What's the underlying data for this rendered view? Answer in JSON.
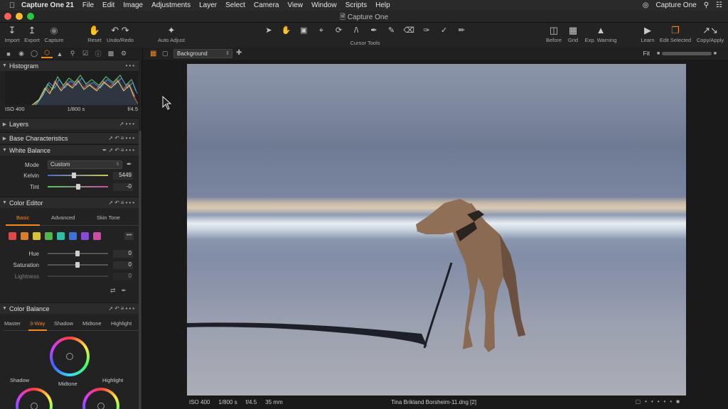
{
  "menubar": {
    "app": "Capture One 21",
    "items": [
      "File",
      "Edit",
      "Image",
      "Adjustments",
      "Layer",
      "Select",
      "Camera",
      "View",
      "Window",
      "Scripts",
      "Help"
    ],
    "right_app": "Capture One"
  },
  "window_title": "Capture One",
  "toolbar": {
    "import": "Import",
    "export": "Export",
    "capture": "Capture",
    "reset": "Reset",
    "undo_redo": "Undo/Redo",
    "auto_adjust": "Auto Adjust",
    "cursor_tools": "Cursor Tools",
    "before": "Before",
    "grid": "Grid",
    "exp_warning": "Exp. Warning",
    "learn": "Learn",
    "edit_selected": "Edit Selected",
    "copy_apply": "Copy/Apply"
  },
  "viewer_header": {
    "layer_select": "Background",
    "zoom_label": "Fit"
  },
  "histogram": {
    "title": "Histogram",
    "iso": "ISO 400",
    "shutter": "1/800 s",
    "aperture": "f/4.5"
  },
  "sections": {
    "layers": "Layers",
    "base_characteristics": "Base Characteristics",
    "white_balance": "White Balance",
    "color_editor": "Color Editor",
    "color_balance": "Color Balance"
  },
  "white_balance": {
    "mode_label": "Mode",
    "mode_value": "Custom",
    "kelvin_label": "Kelvin",
    "kelvin_value": "5449",
    "kelvin_level": 0.43,
    "tint_label": "Tint",
    "tint_value": "-0",
    "tint_level": 0.5
  },
  "color_editor": {
    "tabs": [
      "Basic",
      "Advanced",
      "Skin Tone"
    ],
    "swatches": [
      "#d94a4a",
      "#e07b2a",
      "#d9c23a",
      "#4fb84a",
      "#2fbfa8",
      "#3a73d9",
      "#8a4ad9",
      "#d24aa8"
    ],
    "hue_label": "Hue",
    "hue_value": "0",
    "saturation_label": "Saturation",
    "saturation_value": "0",
    "lightness_label": "Lightness",
    "lightness_value": "0"
  },
  "color_balance": {
    "tabs": [
      "Master",
      "3-Way",
      "Shadow",
      "Midtone",
      "Highlight"
    ],
    "shadow": "Shadow",
    "midtone": "Midtone",
    "highlight": "Highlight"
  },
  "statusbar": {
    "iso": "ISO 400",
    "shutter": "1/800 s",
    "aperture": "f/4.5",
    "focal": "35 mm",
    "filename": "Tina Brikland Borsheim-11.dng [2]"
  },
  "colors": {
    "accent": "#f28a1e"
  }
}
